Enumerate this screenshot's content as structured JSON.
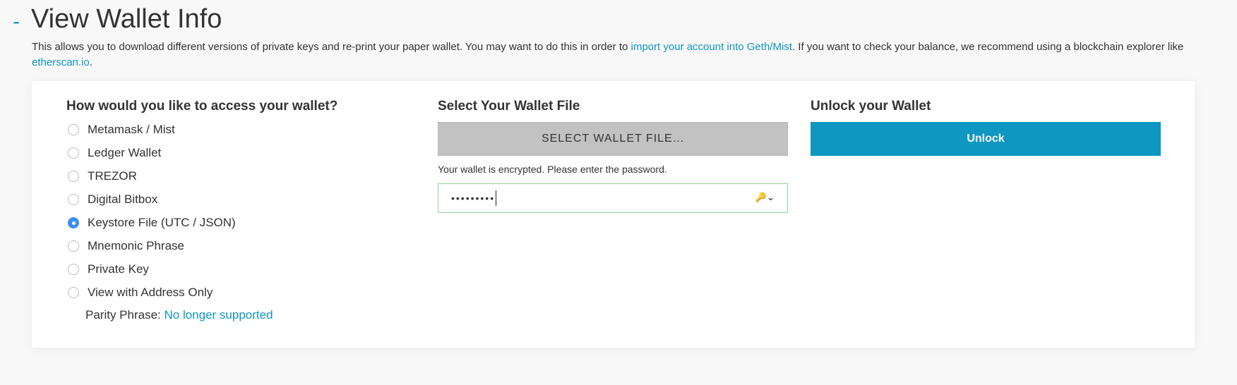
{
  "header": {
    "dash": "-",
    "title": "View Wallet Info",
    "desc_1": "This allows you to download different versions of private keys and re-print your paper wallet. You may want to do this in order to ",
    "link_geth": "import your account into Geth/Mist",
    "desc_2": ". If you want to check your balance, we recommend using a blockchain explorer like ",
    "link_etherscan": "etherscan.io",
    "desc_3": "."
  },
  "access": {
    "heading": "How would you like to access your wallet?",
    "options": [
      {
        "label": "Metamask / Mist",
        "selected": false
      },
      {
        "label": "Ledger Wallet",
        "selected": false
      },
      {
        "label": "TREZOR",
        "selected": false
      },
      {
        "label": "Digital Bitbox",
        "selected": false
      },
      {
        "label": "Keystore File (UTC / JSON)",
        "selected": true
      },
      {
        "label": "Mnemonic Phrase",
        "selected": false
      },
      {
        "label": "Private Key",
        "selected": false
      },
      {
        "label": "View with Address Only",
        "selected": false
      }
    ],
    "parity_label": "Parity Phrase:",
    "parity_link": "No longer supported"
  },
  "file": {
    "heading": "Select Your Wallet File",
    "button": "SELECT WALLET FILE...",
    "encrypted_msg": "Your wallet is encrypted. Please enter the password.",
    "password_value": "•••••••••"
  },
  "unlock": {
    "heading": "Unlock your Wallet",
    "button": "Unlock"
  },
  "colors": {
    "accent": "#0e97c0",
    "radio_selected": "#3b8ff0",
    "file_button": "#c2c2c2"
  }
}
